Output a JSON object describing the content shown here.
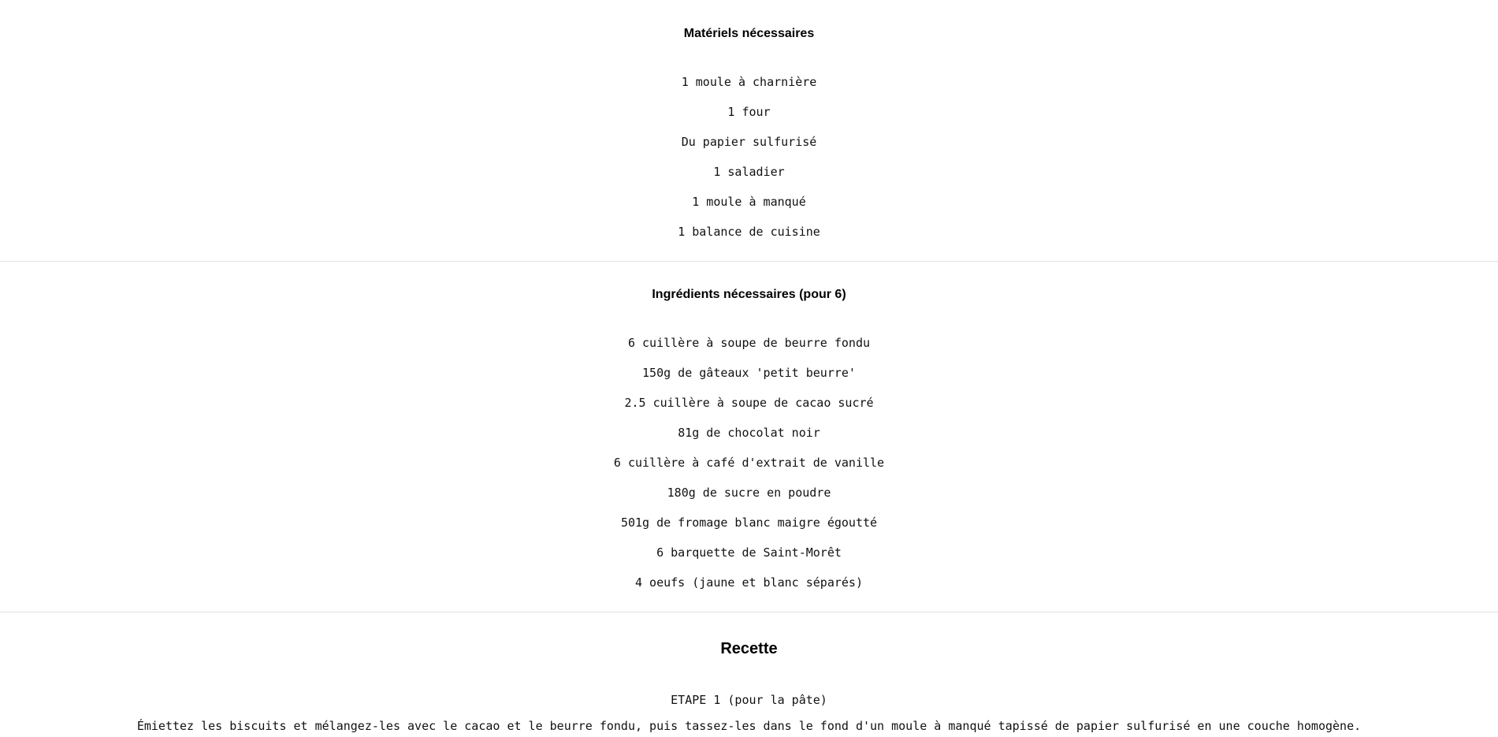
{
  "materials": {
    "title": "Matériels nécessaires",
    "items": [
      "1 moule à charnière",
      "1 four",
      "Du papier sulfurisé",
      "1 saladier",
      "1 moule à manqué",
      "1 balance de cuisine"
    ]
  },
  "ingredients": {
    "title": "Ingrédients nécessaires (pour 6)",
    "items": [
      "6 cuillère à soupe de beurre fondu",
      "150g de gâteaux 'petit beurre'",
      "2.5 cuillère à soupe de cacao sucré",
      "81g de chocolat noir",
      "6 cuillère à café d'extrait de vanille",
      "180g de sucre en poudre",
      "501g de fromage blanc maigre égoutté",
      "6 barquette de Saint-Morêt",
      "4 oeufs (jaune et blanc séparés)"
    ]
  },
  "recipe": {
    "title": "Recette",
    "steps": [
      {
        "label": "ETAPE 1 (pour la pâte)",
        "text": "Émiettez les biscuits et mélangez-les avec le cacao et le beurre fondu, puis tassez-les dans le fond d'un moule à manqué tapissé de papier sulfurisé en une couche homogène."
      }
    ]
  }
}
